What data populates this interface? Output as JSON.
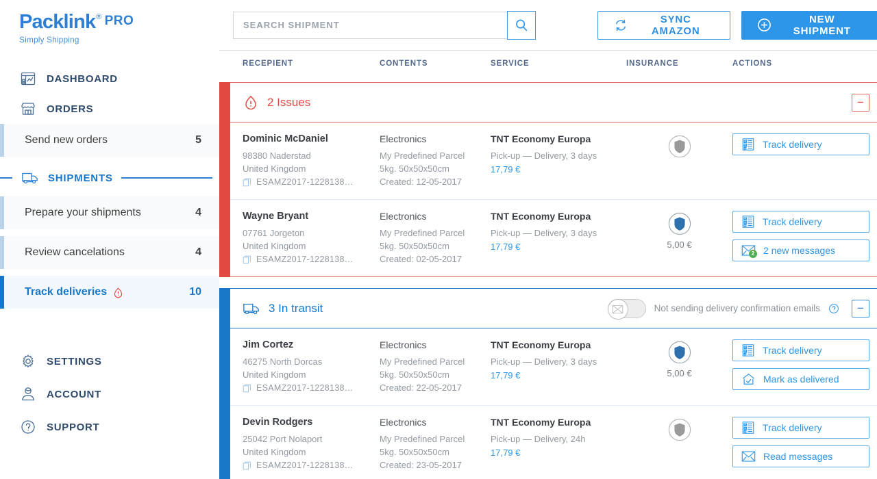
{
  "brand": {
    "name": "Packlink",
    "registered": "®",
    "pro": "PRO",
    "tagline": "Simply Shipping"
  },
  "sidebar": {
    "main_items": [
      {
        "label": "DASHBOARD",
        "icon": "dashboard-icon"
      },
      {
        "label": "ORDERS",
        "icon": "store-icon"
      }
    ],
    "orders_sub": [
      {
        "label": "Send new orders",
        "count": "5"
      }
    ],
    "shipments_section": {
      "label": "SHIPMENTS",
      "icon": "truck-icon"
    },
    "shipments_sub": [
      {
        "label": "Prepare your shipments",
        "count": "4",
        "active": false,
        "alert": false
      },
      {
        "label": "Review cancelations",
        "count": "4",
        "active": false,
        "alert": false
      },
      {
        "label": "Track deliveries",
        "count": "10",
        "active": true,
        "alert": true
      }
    ],
    "bottom_items": [
      {
        "label": "SETTINGS",
        "icon": "gear-icon"
      },
      {
        "label": "ACCOUNT",
        "icon": "user-icon"
      },
      {
        "label": "SUPPORT",
        "icon": "question-icon"
      }
    ]
  },
  "topbar": {
    "search_placeholder": "SEARCH SHIPMENT",
    "search_value": "",
    "search_button_icon": "search-icon",
    "sync_label": "SYNC AMAZON",
    "sync_icon": "refresh-icon",
    "new_shipment_label": "NEW SHIPMENT",
    "new_shipment_icon": "plus-circle-icon"
  },
  "columns": {
    "recipient": "RECEPIENT",
    "contents": "CONTENTS",
    "service": "SERVICE",
    "insurance": "INSURANCE",
    "actions": "ACTIONS"
  },
  "colors": {
    "brand_blue": "#2e7fd4",
    "accent_blue": "#2e96e8",
    "issue_red": "#e34b42",
    "transit_blue": "#1877c9",
    "badge_green": "#4caf50"
  },
  "groups": [
    {
      "id": "issues",
      "title": "2 Issues",
      "icon": "alert-icon",
      "collapse_label": "−",
      "has_toggle": false,
      "rows": [
        {
          "name": "Dominic McDaniel",
          "address_line": "98380  Naderstad",
          "country": "United Kingdom",
          "reference": "ESAMZ2017-1228138…",
          "contents_title": "Electronics",
          "parcel": "My Predefined Parcel",
          "dimensions": "5kg. 50x50x50cm",
          "created": "Created: 12-05-2017",
          "service_name": "TNT Economy Europa",
          "service_detail": "Pick-up — Delivery, 3 days",
          "price": "17,79 €",
          "insurance_active": false,
          "insurance_value": "",
          "actions": [
            {
              "label": "Track delivery",
              "icon": "checklist-icon",
              "badge": ""
            }
          ]
        },
        {
          "name": "Wayne Bryant",
          "address_line": "07761  Jorgeton",
          "country": "United Kingdom",
          "reference": "ESAMZ2017-1228138…",
          "contents_title": "Electronics",
          "parcel": "My Predefined Parcel",
          "dimensions": "5kg. 50x50x50cm",
          "created": "Created: 02-05-2017",
          "service_name": "TNT Economy Europa",
          "service_detail": "Pick-up — Delivery, 3 days",
          "price": "17,79 €",
          "insurance_active": true,
          "insurance_value": "5,00 €",
          "actions": [
            {
              "label": "Track delivery",
              "icon": "checklist-icon",
              "badge": ""
            },
            {
              "label": "2 new messages",
              "icon": "envelope-icon",
              "badge": "2"
            }
          ]
        }
      ]
    },
    {
      "id": "transit",
      "title": "3 In transit",
      "icon": "truck-icon",
      "collapse_label": "−",
      "has_toggle": true,
      "toggle_state": "off",
      "toggle_icon": "envelope-icon",
      "toggle_label": "Not sending delivery confirmation emails",
      "toggle_help_icon": "question-circle-icon",
      "rows": [
        {
          "name": "Jim Cortez",
          "address_line": "46275  North Dorcas",
          "country": "United Kingdom",
          "reference": "ESAMZ2017-1228138…",
          "contents_title": "Electronics",
          "parcel": "My Predefined Parcel",
          "dimensions": "5kg. 50x50x50cm",
          "created": "Created: 22-05-2017",
          "service_name": "TNT Economy Europa",
          "service_detail": "Pick-up — Delivery, 3 days",
          "price": "17,79 €",
          "insurance_active": true,
          "insurance_value": "5,00 €",
          "actions": [
            {
              "label": "Track delivery",
              "icon": "checklist-icon",
              "badge": ""
            },
            {
              "label": "Mark as delivered",
              "icon": "home-check-icon",
              "badge": ""
            }
          ]
        },
        {
          "name": "Devin Rodgers",
          "address_line": "25042  Port Nolaport",
          "country": "United Kingdom",
          "reference": "ESAMZ2017-1228138…",
          "contents_title": "Electronics",
          "parcel": "My Predefined Parcel",
          "dimensions": "5kg. 50x50x50cm",
          "created": "Created: 23-05-2017",
          "service_name": "TNT Economy Europa",
          "service_detail": "Pick-up — Delivery, 24h",
          "price": "17,79 €",
          "insurance_active": false,
          "insurance_value": "",
          "actions": [
            {
              "label": "Track delivery",
              "icon": "checklist-icon",
              "badge": ""
            },
            {
              "label": "Read messages",
              "icon": "envelope-icon",
              "badge": ""
            }
          ]
        }
      ]
    }
  ]
}
